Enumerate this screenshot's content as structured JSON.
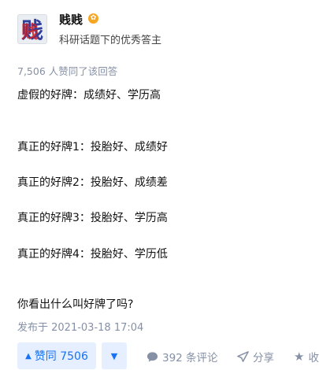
{
  "author": {
    "avatar_char": "贱",
    "name": "贱贱",
    "description": "科研话题下的优秀答主"
  },
  "answer": {
    "votes_text": "7,506 人赞同了该回答",
    "lines": [
      "虚假的好牌：成绩好、学历高",
      "真正的好牌1：投胎好、成绩好",
      "真正的好牌2：投胎好、成绩差",
      "真正的好牌3：投胎好、学历高",
      "真正的好牌4：投胎好、学历低",
      "你看出什么叫好牌了吗?"
    ],
    "published": "发布于 2021-03-18 17:04"
  },
  "actions": {
    "vote_label": "赞同 7506",
    "comments_label": "392 条评论",
    "share_label": "分享",
    "favorite_label": "收"
  },
  "colors": {
    "accent": "#1772f6",
    "muted": "#8590a6",
    "badge": "#f5a623"
  },
  "icons": [
    "upvote-triangle-icon",
    "downvote-triangle-icon",
    "comment-bubble-icon",
    "share-paper-plane-icon",
    "star-icon",
    "excellent-badge-icon"
  ]
}
